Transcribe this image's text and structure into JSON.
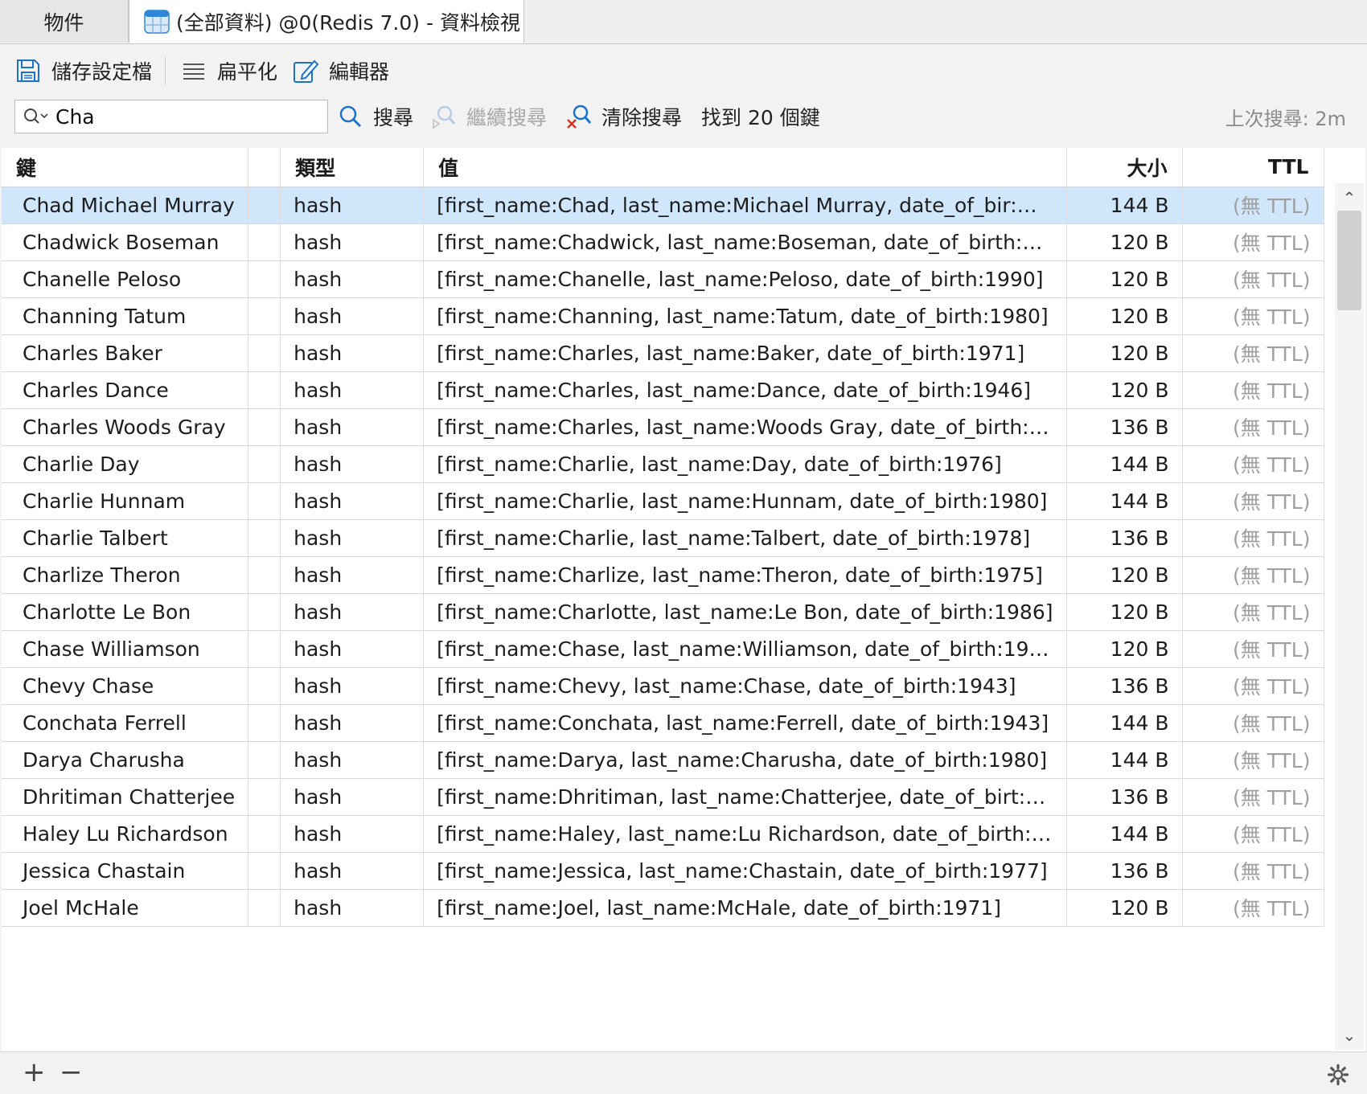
{
  "tabs": {
    "objects_label": "物件",
    "active_label": "(全部資料) @0(Redis 7.0) - 資料檢視"
  },
  "toolbar": {
    "save_profile_label": "儲存設定檔",
    "flatten_label": "扁平化",
    "editor_label": "編輯器"
  },
  "search": {
    "value": "Cha",
    "search_label": "搜尋",
    "continue_label": "繼續搜尋",
    "clear_label": "清除搜尋",
    "found_text": "找到 20 個鍵",
    "last_search": "上次搜尋: 2m"
  },
  "table": {
    "columns": [
      "鍵",
      "",
      "類型",
      "值",
      "大小",
      "TTL"
    ],
    "selected_row": 0,
    "rows": [
      {
        "key": "Chad Michael Murray",
        "type": "hash",
        "value": "[first_name:Chad, last_name:Michael Murray, date_of_bir:…",
        "size": "144 B",
        "ttl": "(無 TTL)"
      },
      {
        "key": "Chadwick Boseman",
        "type": "hash",
        "value": "[first_name:Chadwick, last_name:Boseman, date_of_birth:…",
        "size": "120 B",
        "ttl": "(無 TTL)"
      },
      {
        "key": "Chanelle Peloso",
        "type": "hash",
        "value": "[first_name:Chanelle, last_name:Peloso, date_of_birth:1990]",
        "size": "120 B",
        "ttl": "(無 TTL)"
      },
      {
        "key": "Channing Tatum",
        "type": "hash",
        "value": "[first_name:Channing, last_name:Tatum, date_of_birth:1980]",
        "size": "120 B",
        "ttl": "(無 TTL)"
      },
      {
        "key": "Charles Baker",
        "type": "hash",
        "value": "[first_name:Charles, last_name:Baker, date_of_birth:1971]",
        "size": "120 B",
        "ttl": "(無 TTL)"
      },
      {
        "key": "Charles Dance",
        "type": "hash",
        "value": "[first_name:Charles, last_name:Dance, date_of_birth:1946]",
        "size": "120 B",
        "ttl": "(無 TTL)"
      },
      {
        "key": "Charles Woods Gray",
        "type": "hash",
        "value": "[first_name:Charles, last_name:Woods Gray, date_of_birth:…",
        "size": "136 B",
        "ttl": "(無 TTL)"
      },
      {
        "key": "Charlie Day",
        "type": "hash",
        "value": "[first_name:Charlie, last_name:Day, date_of_birth:1976]",
        "size": "144 B",
        "ttl": "(無 TTL)"
      },
      {
        "key": "Charlie Hunnam",
        "type": "hash",
        "value": "[first_name:Charlie, last_name:Hunnam, date_of_birth:1980]",
        "size": "144 B",
        "ttl": "(無 TTL)"
      },
      {
        "key": "Charlie Talbert",
        "type": "hash",
        "value": "[first_name:Charlie, last_name:Talbert, date_of_birth:1978]",
        "size": "136 B",
        "ttl": "(無 TTL)"
      },
      {
        "key": "Charlize Theron",
        "type": "hash",
        "value": "[first_name:Charlize, last_name:Theron, date_of_birth:1975]",
        "size": "120 B",
        "ttl": "(無 TTL)"
      },
      {
        "key": "Charlotte Le Bon",
        "type": "hash",
        "value": "[first_name:Charlotte, last_name:Le Bon, date_of_birth:1986]",
        "size": "120 B",
        "ttl": "(無 TTL)"
      },
      {
        "key": "Chase Williamson",
        "type": "hash",
        "value": "[first_name:Chase, last_name:Williamson, date_of_birth:19…",
        "size": "120 B",
        "ttl": "(無 TTL)"
      },
      {
        "key": "Chevy Chase",
        "type": "hash",
        "value": "[first_name:Chevy, last_name:Chase, date_of_birth:1943]",
        "size": "136 B",
        "ttl": "(無 TTL)"
      },
      {
        "key": "Conchata Ferrell",
        "type": "hash",
        "value": "[first_name:Conchata, last_name:Ferrell, date_of_birth:1943]",
        "size": "144 B",
        "ttl": "(無 TTL)"
      },
      {
        "key": "Darya Charusha",
        "type": "hash",
        "value": "[first_name:Darya, last_name:Charusha, date_of_birth:1980]",
        "size": "144 B",
        "ttl": "(無 TTL)"
      },
      {
        "key": "Dhritiman Chatterjee",
        "type": "hash",
        "value": "[first_name:Dhritiman, last_name:Chatterjee, date_of_birt:…",
        "size": "136 B",
        "ttl": "(無 TTL)"
      },
      {
        "key": "Haley Lu Richardson",
        "type": "hash",
        "value": "[first_name:Haley, last_name:Lu Richardson, date_of_birth:…",
        "size": "144 B",
        "ttl": "(無 TTL)"
      },
      {
        "key": "Jessica Chastain",
        "type": "hash",
        "value": "[first_name:Jessica, last_name:Chastain, date_of_birth:1977]",
        "size": "136 B",
        "ttl": "(無 TTL)"
      },
      {
        "key": "Joel McHale",
        "type": "hash",
        "value": "[first_name:Joel, last_name:McHale, date_of_birth:1971]",
        "size": "120 B",
        "ttl": "(無 TTL)"
      }
    ]
  },
  "bottom": {
    "add_label": "+",
    "remove_label": "−"
  },
  "colors": {
    "selected_row": "#cfe6fb",
    "accent_blue": "#1a73c9",
    "clear_red": "#d93025"
  },
  "icons": [
    "table-icon",
    "save-icon",
    "flatten-icon",
    "editor-icon",
    "search-icon",
    "continue-search-icon",
    "clear-search-icon",
    "scroll-up-icon",
    "scroll-down-icon",
    "gear-icon"
  ]
}
